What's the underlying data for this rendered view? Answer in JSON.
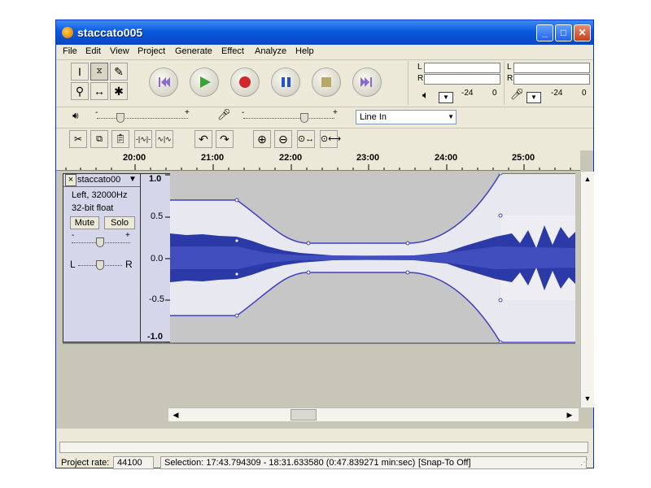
{
  "window": {
    "title": "staccato005",
    "minimize_label": "_",
    "maximize_label": "□",
    "close_label": "✕"
  },
  "menu": [
    "File",
    "Edit",
    "View",
    "Project",
    "Generate",
    "Effect",
    "Analyze",
    "Help"
  ],
  "meters": {
    "left_label": "L",
    "right_label": "R",
    "db_labels": [
      "-24",
      "0"
    ]
  },
  "mixer": {
    "minus": "-",
    "plus": "+",
    "input_source": "Line In"
  },
  "timeline": {
    "ticks": [
      "20:00",
      "21:00",
      "22:00",
      "23:00",
      "24:00",
      "25:00"
    ]
  },
  "track": {
    "name": "staccato00",
    "close_label": "×",
    "channel_info": "Left, 32000Hz",
    "format": "32-bit float",
    "mute_label": "Mute",
    "solo_label": "Solo",
    "gain_minus": "-",
    "gain_plus": "+",
    "pan_left": "L",
    "pan_right": "R",
    "scale": [
      "1.0",
      "0.5",
      "0.0",
      "-0.5",
      "-1.0"
    ]
  },
  "status": {
    "project_rate_label": "Project rate:",
    "project_rate_value": "44100",
    "selection_text": "Selection: 17:43.794309 - 18:31.633580 (0:47.839271 min:sec)",
    "snap_text": "[Snap-To Off]"
  },
  "colors": {
    "titlebar": "#0a5ade",
    "waveform": "#2b3aa6",
    "track_panel": "#d6d6ea",
    "envelope": "#4040c0"
  }
}
